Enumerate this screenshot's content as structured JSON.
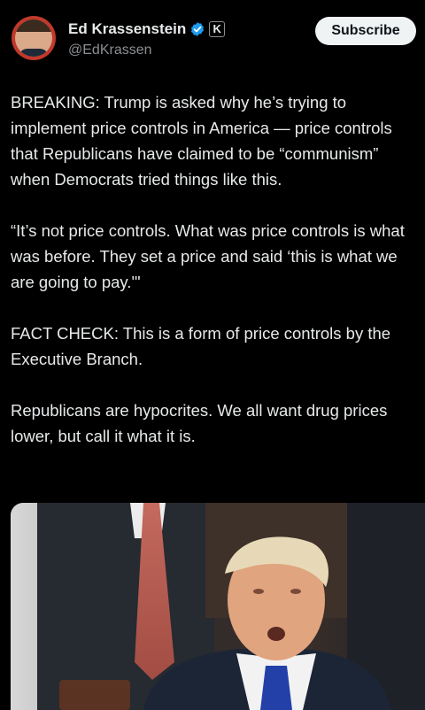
{
  "author": {
    "display_name": "Ed Krassenstein",
    "handle": "@EdKrassen",
    "verified_icon": "verified-badge-icon",
    "affiliate_badge": "K"
  },
  "actions": {
    "subscribe_label": "Subscribe"
  },
  "tweet": {
    "paragraphs": [
      "BREAKING: Trump is asked why he’s trying to implement price controls in America — price controls that Republicans have claimed to be “communism” when Democrats tried things like this.",
      "“It’s not price controls. What was price controls is what was before. They set a price and said ‘this is what we are going to pay.'\"",
      "FACT CHECK:  This is a form of price controls by the Executive Branch.",
      "Republicans are hypocrites.  We all want drug prices lower, but call it what it is."
    ]
  },
  "colors": {
    "background": "#000000",
    "text": "#e7e9ea",
    "muted": "#8b8f94",
    "verified_blue": "#1d9bf0",
    "button_bg": "#eff3f4"
  }
}
